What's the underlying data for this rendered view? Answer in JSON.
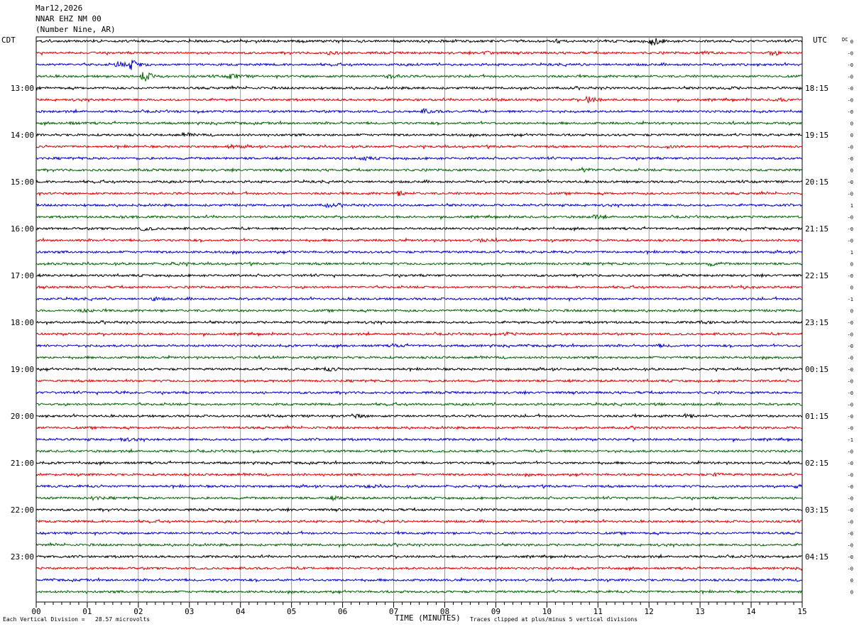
{
  "header": {
    "date": "Mar12,2026",
    "station": "NNAR EHZ NM 00",
    "location": "(Number Nine, AR)"
  },
  "left_label": "CDT",
  "right_label": "UTC",
  "dc_label": "DC",
  "footer": {
    "scale_note": "Each Vertical Division =   28.57 microvolts",
    "clip_note": "Traces clipped at plus/minus 5 vertical divisions",
    "x_title": "TIME (MINUTES)"
  },
  "colors": {
    "trace_cycle": [
      "#000000",
      "#dd0000",
      "#0000cc",
      "#006400"
    ],
    "grid": "#808080"
  },
  "chart_data": {
    "type": "line",
    "title": "NNAR EHZ NM 00",
    "xlabel": "TIME (MINUTES)",
    "xlim": [
      0,
      15
    ],
    "x_ticks": [
      "00",
      "01",
      "02",
      "03",
      "04",
      "05",
      "06",
      "07",
      "08",
      "09",
      "10",
      "11",
      "12",
      "13",
      "14",
      "15"
    ],
    "trace_count": 48,
    "minutes_per_trace": 15,
    "left_hour_labels": [
      "13:00",
      "14:00",
      "15:00",
      "16:00",
      "17:00",
      "18:00",
      "19:00",
      "20:00",
      "21:00",
      "22:00",
      "23:00"
    ],
    "right_hour_labels": [
      "18:15",
      "19:15",
      "20:15",
      "21:15",
      "22:15",
      "23:15",
      "00:15",
      "01:15",
      "02:15",
      "03:15",
      "04:15"
    ],
    "dc_offsets": [
      "0",
      "-0",
      "-0",
      "-0",
      "-0",
      "-0",
      "-0",
      "0",
      "0",
      "-0",
      "-0",
      "0",
      "-0",
      "-0",
      "1",
      "-0",
      "-0",
      "-0",
      "1",
      "0",
      "-0",
      "0",
      "-1",
      "0",
      "-0",
      "-0",
      "-0",
      "-0",
      "-0",
      "-0",
      "-0",
      "-0",
      "-0",
      "-0",
      "-1",
      "-0",
      "-0",
      "-0",
      "-0",
      "-0",
      "-0",
      "-0",
      "-0",
      "-0",
      "-0",
      "-0",
      "0",
      "0"
    ],
    "events": [
      {
        "trace": 0,
        "minute": 10.2,
        "amp": 2.0
      },
      {
        "trace": 0,
        "minute": 12.05,
        "amp": 6.0
      },
      {
        "trace": 1,
        "minute": 5.7,
        "amp": 2.0
      },
      {
        "trace": 1,
        "minute": 8.8,
        "amp": 2.2
      },
      {
        "trace": 1,
        "minute": 13.1,
        "amp": 1.6
      },
      {
        "trace": 1,
        "minute": 14.4,
        "amp": 3.0
      },
      {
        "trace": 2,
        "minute": 1.6,
        "amp": 3.5
      },
      {
        "trace": 2,
        "minute": 1.85,
        "amp": 6.5
      },
      {
        "trace": 3,
        "minute": 2.1,
        "amp": 7.0
      },
      {
        "trace": 3,
        "minute": 3.8,
        "amp": 4.0
      },
      {
        "trace": 3,
        "minute": 6.9,
        "amp": 3.0
      },
      {
        "trace": 4,
        "minute": 13.5,
        "amp": 1.5
      },
      {
        "trace": 5,
        "minute": 8.9,
        "amp": 1.8
      },
      {
        "trace": 5,
        "minute": 10.8,
        "amp": 4.5
      },
      {
        "trace": 5,
        "minute": 14.5,
        "amp": 2.0
      },
      {
        "trace": 6,
        "minute": 7.6,
        "amp": 3.0
      },
      {
        "trace": 7,
        "minute": 0.6,
        "amp": 1.5
      },
      {
        "trace": 8,
        "minute": 2.9,
        "amp": 2.0
      },
      {
        "trace": 9,
        "minute": 3.8,
        "amp": 2.0
      },
      {
        "trace": 9,
        "minute": 12.3,
        "amp": 1.8
      },
      {
        "trace": 10,
        "minute": 6.4,
        "amp": 2.2
      },
      {
        "trace": 11,
        "minute": 10.7,
        "amp": 2.5
      },
      {
        "trace": 13,
        "minute": 7.1,
        "amp": 2.5
      },
      {
        "trace": 14,
        "minute": 5.7,
        "amp": 2.0
      },
      {
        "trace": 15,
        "minute": 1.7,
        "amp": 2.0
      },
      {
        "trace": 15,
        "minute": 10.9,
        "amp": 2.8
      },
      {
        "trace": 16,
        "minute": 2.1,
        "amp": 2.2
      },
      {
        "trace": 17,
        "minute": 8.7,
        "amp": 1.8
      },
      {
        "trace": 19,
        "minute": 2.7,
        "amp": 1.8
      },
      {
        "trace": 19,
        "minute": 13.2,
        "amp": 2.0
      },
      {
        "trace": 21,
        "minute": 13.8,
        "amp": 2.0
      },
      {
        "trace": 22,
        "minute": 2.3,
        "amp": 2.0
      },
      {
        "trace": 23,
        "minute": 0.9,
        "amp": 1.8
      },
      {
        "trace": 24,
        "minute": 13.0,
        "amp": 1.6
      },
      {
        "trace": 25,
        "minute": 9.2,
        "amp": 1.8
      },
      {
        "trace": 26,
        "minute": 7.0,
        "amp": 1.8
      },
      {
        "trace": 26,
        "minute": 12.2,
        "amp": 1.4
      },
      {
        "trace": 28,
        "minute": 5.7,
        "amp": 2.5
      },
      {
        "trace": 30,
        "minute": 1.6,
        "amp": 1.8
      },
      {
        "trace": 31,
        "minute": 12.1,
        "amp": 1.8
      },
      {
        "trace": 32,
        "minute": 6.2,
        "amp": 2.5
      },
      {
        "trace": 32,
        "minute": 12.7,
        "amp": 2.0
      },
      {
        "trace": 34,
        "minute": 1.7,
        "amp": 2.0
      },
      {
        "trace": 37,
        "minute": 13.3,
        "amp": 1.6
      },
      {
        "trace": 38,
        "minute": 6.5,
        "amp": 1.8
      },
      {
        "trace": 38,
        "minute": 14.9,
        "amp": 1.6
      },
      {
        "trace": 39,
        "minute": 1.1,
        "amp": 2.2
      },
      {
        "trace": 39,
        "minute": 5.8,
        "amp": 1.8
      }
    ]
  }
}
